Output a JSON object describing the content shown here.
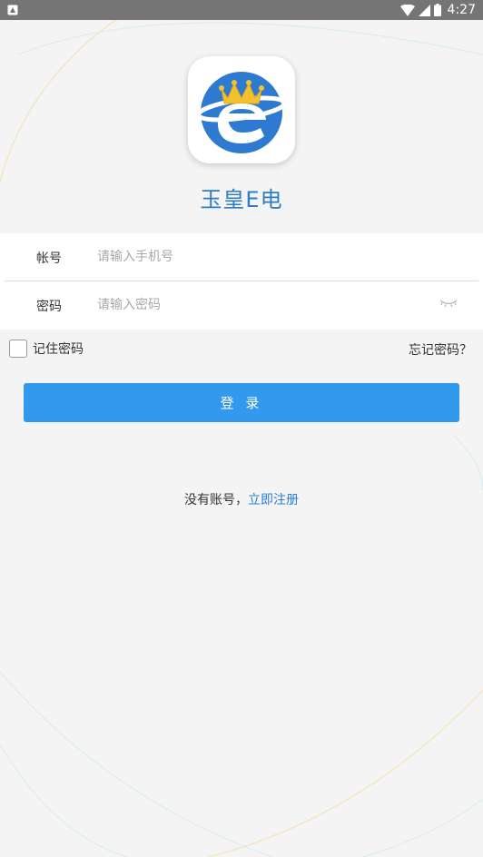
{
  "status_bar": {
    "time": "4:27"
  },
  "app": {
    "name": "玉皇E电"
  },
  "form": {
    "account_label": "帐号",
    "account_placeholder": "请输入手机号",
    "password_label": "密码",
    "password_placeholder": "请输入密码"
  },
  "options": {
    "remember_label": "记住密码",
    "forgot_label": "忘记密码？"
  },
  "login_button": {
    "label": "登 录"
  },
  "register": {
    "prompt": "没有账号，",
    "link": "立即注册"
  },
  "colors": {
    "brand_blue": "#3399ee",
    "title_blue": "#2f7dc0",
    "link_blue": "#2a7fd4",
    "crown_gold": "#f2c12e"
  }
}
